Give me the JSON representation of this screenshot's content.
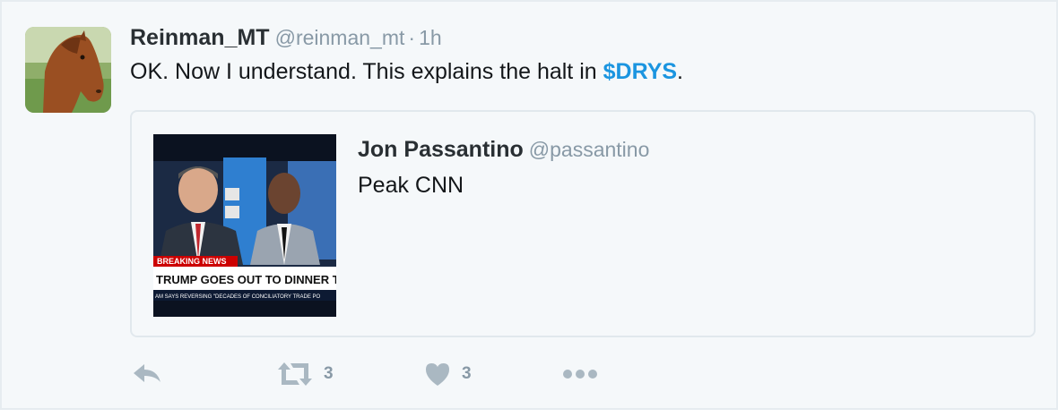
{
  "tweet": {
    "author_name": "Reinman_MT",
    "author_handle": "@reinman_mt",
    "separator": "·",
    "time": "1h",
    "text_before": "OK. Now I understand. This explains the halt in ",
    "cashtag": "$DRYS",
    "text_after": "."
  },
  "quoted": {
    "author_name": "Jon Passantino",
    "author_handle": "@passantino",
    "text": "Peak CNN",
    "media": {
      "breaking_label": "BREAKING NEWS",
      "headline": "TRUMP GOES OUT TO DINNER T",
      "ticker": "AM SAYS REVERSING \"DECADES OF CONCILIATORY TRADE PO"
    }
  },
  "actions": {
    "retweet_count": "3",
    "like_count": "3"
  },
  "colors": {
    "link": "#1b95e0",
    "muted": "#8899a6",
    "text": "#14171a",
    "icon": "#aab8c2"
  }
}
